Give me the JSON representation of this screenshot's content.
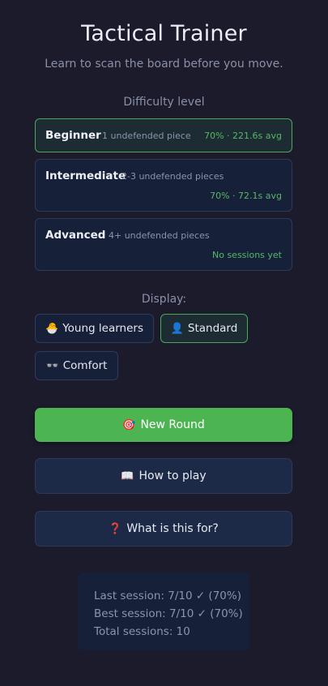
{
  "header": {
    "title": "Tactical Trainer",
    "subtitle": "Learn to scan the board before you move."
  },
  "difficulty": {
    "label": "Difficulty level",
    "levels": [
      {
        "name": "Beginner",
        "description": "1 undefended piece",
        "stats": "70% · 221.6s avg",
        "selected": true
      },
      {
        "name": "Intermediate",
        "description": "2-3 undefended pieces",
        "stats": "70% · 72.1s avg",
        "selected": false
      },
      {
        "name": "Advanced",
        "description": "4+ undefended pieces",
        "stats": "No sessions yet",
        "selected": false
      }
    ]
  },
  "display": {
    "label": "Display:",
    "options": [
      {
        "icon": "🐣",
        "icon_name": "chick-icon",
        "label": "Young learners",
        "selected": false
      },
      {
        "icon": "👤",
        "icon_name": "person-icon",
        "label": "Standard",
        "selected": true
      },
      {
        "icon": "👓",
        "icon_name": "glasses-icon",
        "label": "Comfort",
        "selected": false
      }
    ]
  },
  "actions": {
    "new_round": {
      "icon": "🎯",
      "icon_name": "target-icon",
      "label": "New Round"
    },
    "how_to_play": {
      "icon": "📖",
      "icon_name": "book-icon",
      "label": "How to play"
    },
    "what_for": {
      "icon": "❓",
      "icon_name": "question-icon",
      "label": "What is this for?"
    }
  },
  "stats": {
    "last_session": "Last session: 7/10 ✓ (70%)",
    "best_session": "Best session: 7/10 ✓ (70%)",
    "total_sessions": "Total sessions: 10"
  },
  "colors": {
    "background": "#1b1b2c",
    "accent_green": "#4cb552",
    "card": "#172039"
  }
}
